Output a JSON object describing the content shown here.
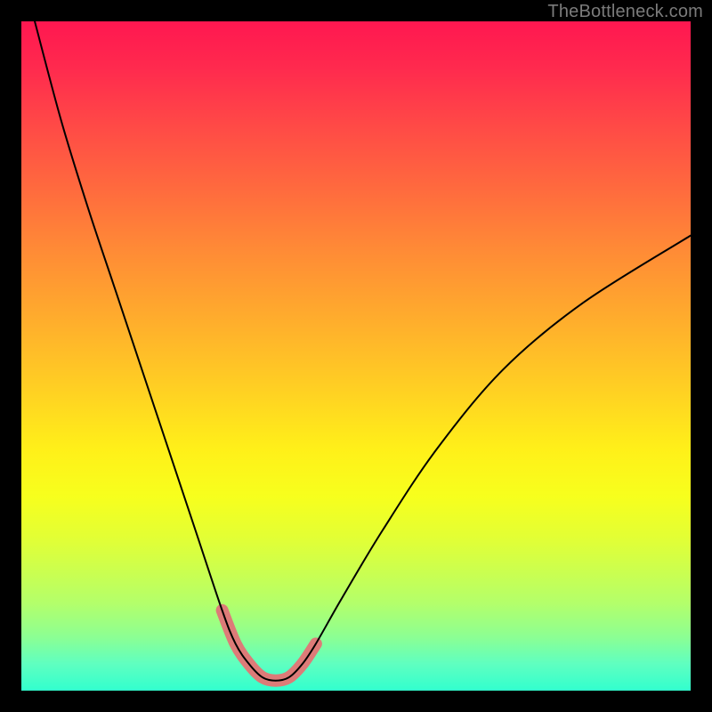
{
  "watermark": "TheBottleneck.com",
  "chart_data": {
    "type": "line",
    "title": "",
    "xlabel": "",
    "ylabel": "",
    "xlim": [
      0,
      100
    ],
    "ylim": [
      0,
      100
    ],
    "grid": false,
    "legend": false,
    "series": [
      {
        "name": "bottleneck-curve",
        "x": [
          2,
          6,
          10,
          14,
          18,
          22,
          26,
          30,
          32,
          34,
          36,
          38,
          40,
          42,
          44,
          48,
          54,
          62,
          72,
          84,
          100
        ],
        "y": [
          100,
          85,
          72,
          60,
          48,
          36,
          24,
          12,
          7,
          4,
          2,
          1.5,
          2,
          4,
          7,
          14,
          24,
          36,
          48,
          58,
          68
        ]
      },
      {
        "name": "highlight-region",
        "x": [
          30,
          32,
          34,
          36,
          38,
          40,
          42,
          44
        ],
        "y": [
          12,
          7,
          4,
          2,
          1.5,
          2,
          4,
          7
        ]
      }
    ],
    "colors": {
      "curve": "#000000",
      "highlight": "#dd7b78",
      "gradient_top": "#ff1750",
      "gradient_bottom": "#32ffce"
    }
  }
}
